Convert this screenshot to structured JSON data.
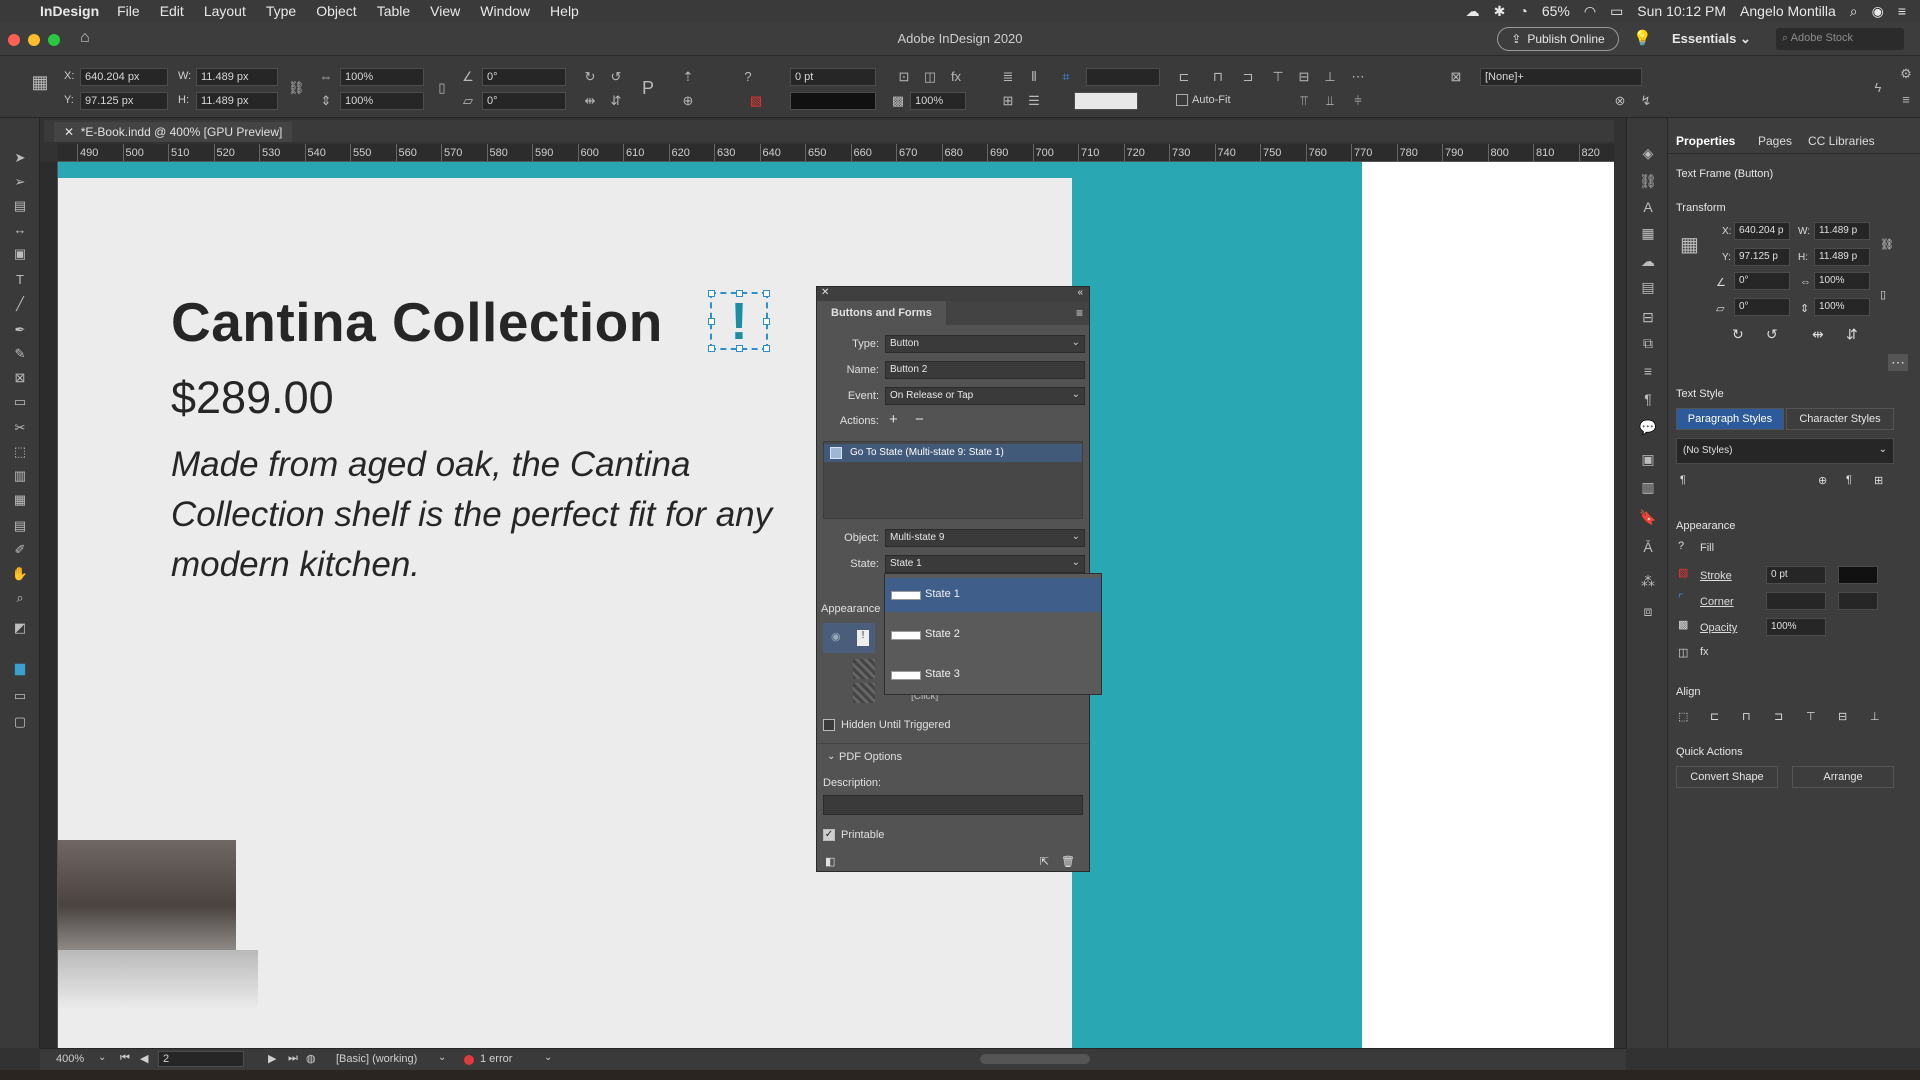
{
  "menubar": {
    "app": "InDesign",
    "items": [
      "File",
      "Edit",
      "Layout",
      "Type",
      "Object",
      "Table",
      "View",
      "Window",
      "Help"
    ],
    "battery": "65%",
    "clock": "Sun 10:12 PM",
    "user": "Angelo Montilla"
  },
  "titlebar": {
    "title": "Adobe InDesign 2020",
    "publish": "Publish Online",
    "workspace": "Essentials",
    "stock_placeholder": "Adobe Stock"
  },
  "control": {
    "x_label": "X:",
    "x": "640.204 px",
    "y_label": "Y:",
    "y": "97.125 px",
    "w_label": "W:",
    "w": "11.489 px",
    "h_label": "H:",
    "h": "11.489 px",
    "scale_x": "100%",
    "scale_y": "100%",
    "angle": "0°",
    "shear": "0°",
    "stroke_weight": "0 pt",
    "opacity": "100%",
    "style": "[None]+",
    "autofit": "Auto-Fit"
  },
  "doc_tab": "*E-Book.indd @ 400% [GPU Preview]",
  "ruler": [
    "490",
    "500",
    "510",
    "520",
    "530",
    "540",
    "550",
    "560",
    "570",
    "580",
    "590",
    "600",
    "610",
    "620",
    "630",
    "640",
    "650",
    "660",
    "670",
    "680",
    "690",
    "700",
    "710",
    "720",
    "730",
    "740",
    "750",
    "760",
    "770",
    "780",
    "790",
    "800",
    "810",
    "820"
  ],
  "page": {
    "heading": "Cantina Collection",
    "button_glyph": "!",
    "price": "$289.00",
    "description": "Made from aged oak, the Cantina Collection shelf is the perfect fit for any modern kitchen."
  },
  "buttons_forms": {
    "title": "Buttons and Forms",
    "type_label": "Type:",
    "type": "Button",
    "name_label": "Name:",
    "name": "Button 2",
    "event_label": "Event:",
    "event": "On Release or Tap",
    "actions_label": "Actions:",
    "action_item": "Go To State (Multi-state 9: State 1)",
    "object_label": "Object:",
    "object": "Multi-state 9",
    "state_label": "State:",
    "state": "State 1",
    "appearance_label": "Appearance",
    "click_label": "[Click]",
    "hidden_label": "Hidden Until Triggered",
    "pdf_options": "PDF Options",
    "description_label": "Description:",
    "printable_label": "Printable",
    "dropdown": [
      "State 1",
      "State 2",
      "State 3"
    ]
  },
  "properties": {
    "tabs": [
      "Properties",
      "Pages",
      "CC Libraries"
    ],
    "selection": "Text Frame (Button)",
    "transform": "Transform",
    "x_label": "X:",
    "x": "640.204 p",
    "y_label": "Y:",
    "y": "97.125 p",
    "w_label": "W:",
    "w": "11.489 p",
    "h_label": "H:",
    "h": "11.489 p",
    "angle": "0°",
    "shear": "0°",
    "scale_x": "100%",
    "scale_y": "100%",
    "text_style": "Text Style",
    "para_styles": "Paragraph Styles",
    "char_styles": "Character Styles",
    "no_styles": "(No Styles)",
    "appearance": "Appearance",
    "fill": "Fill",
    "stroke": "Stroke",
    "stroke_val": "0 pt",
    "corner": "Corner",
    "opacity": "Opacity",
    "opacity_val": "100%",
    "align": "Align",
    "quick_actions": "Quick Actions",
    "convert_shape": "Convert Shape",
    "arrange": "Arrange"
  },
  "status": {
    "zoom": "400%",
    "page": "2",
    "preflight_profile": "[Basic] (working)",
    "errors": "1 error"
  },
  "colors": {
    "teal": "#29a8b4",
    "selection": "#3f5f8a",
    "frame": "#2b8fd0"
  }
}
